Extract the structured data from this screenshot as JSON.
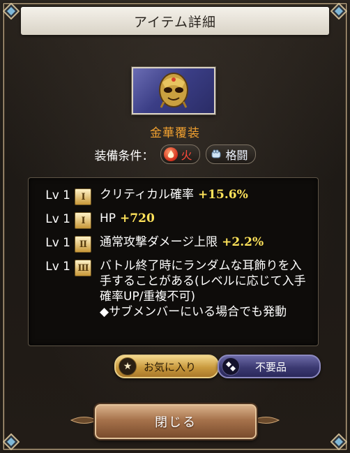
{
  "dialog": {
    "title": "アイテム詳細",
    "item_name": "金華覆装",
    "equip_label": "装備条件：",
    "equip_tags": [
      {
        "label": "火",
        "icon": "fire-element-icon",
        "color": "#ff4a3a"
      },
      {
        "label": "格闘",
        "icon": "fist-weapon-icon",
        "color": "#eef4ff"
      }
    ],
    "skills": [
      {
        "lv": "Lv 1",
        "rank": "I",
        "text": "クリティカル確率",
        "value": "+15.6%"
      },
      {
        "lv": "Lv 1",
        "rank": "I",
        "text": "HP",
        "value": "+720"
      },
      {
        "lv": "Lv 1",
        "rank": "II",
        "text": "通常攻撃ダメージ上限",
        "value": "+2.2%"
      },
      {
        "lv": "Lv 1",
        "rank": "III",
        "text": "バトル終了時にランダムな耳飾りを入手することがある(レベルに応じて入手確率UP/重複不可)\n◆サブメンバーにいる場合でも発動",
        "value": ""
      }
    ],
    "favorite_button": "お気に入り",
    "unneeded_button": "不要品",
    "close_button": "閉じる"
  },
  "colors": {
    "item_name": "#f0a030",
    "skill_value": "#ffe35a",
    "favorite_gold": "#c99a3e",
    "unneeded_purple": "#3c3a72"
  }
}
